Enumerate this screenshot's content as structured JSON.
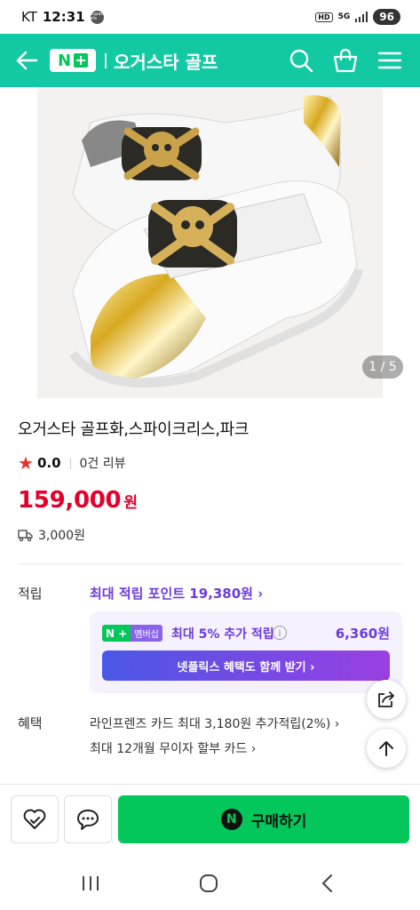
{
  "status_bar": {
    "carrier": "KT",
    "time": "12:31",
    "notification": "coupang eats",
    "hd": "HD",
    "network": "5G",
    "battery": "96"
  },
  "header": {
    "store_name": "오거스타 골프"
  },
  "gallery": {
    "counter": "1 / 5"
  },
  "product": {
    "title": "오거스타 골프화,스파이크리스,파크",
    "rating": "0.0",
    "reviews": "0건 리뷰",
    "price": "159,000",
    "price_unit": "원",
    "shipping": "3,000원"
  },
  "points": {
    "label": "적립",
    "max_points": "최대 적립 포인트 19,380원 ›",
    "member_badge_np": "N +",
    "member_badge_label": "멤버십",
    "member_text": "최대 5% 추가 적립",
    "member_amount": "6,360원",
    "netflix_button": "넷플릭스 혜택도 함께 받기 ›"
  },
  "benefits": {
    "label": "혜택",
    "items": [
      "라인프렌즈 카드 최대 3,180원 추가적립(2%) ›",
      "최대 12개월 무이자 할부 카드 ›"
    ]
  },
  "action_bar": {
    "buy_label": "구매하기"
  },
  "colors": {
    "brand": "#12c9a3",
    "naver_green": "#03c75a",
    "price_red": "#e4002b",
    "membership_purple": "#6c3ce0"
  }
}
